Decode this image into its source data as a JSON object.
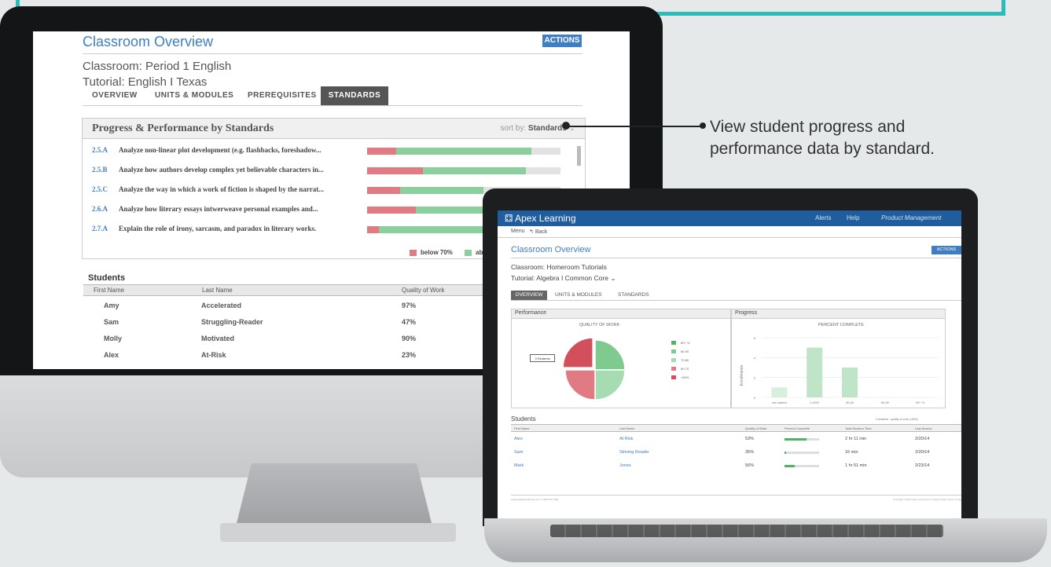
{
  "annotation": {
    "text_line1": "View student progress and",
    "text_line2": "performance data by standard."
  },
  "desktop": {
    "page_title": "Classroom Overview",
    "actions_label": "ACTIONS",
    "classroom": "Classroom: Period 1 English",
    "tutorial": "Tutorial: English I Texas",
    "tabs": [
      "OVERVIEW",
      "UNITS & MODULES",
      "PREREQUISITES",
      "STANDARDS"
    ],
    "active_tab": "STANDARDS",
    "panel_title": "Progress & Performance by Standards",
    "sort_label": "sort by:",
    "sort_value": "Standards",
    "standards": [
      {
        "code": "2.5.A",
        "text": "Analyze non-linear plot development (e.g. flashbacks, foreshadow...",
        "below": 0.15,
        "above": 0.85
      },
      {
        "code": "2.5.B",
        "text": "Analyze how authors develop complex yet believable characters in...",
        "below": 0.29,
        "above": 0.82
      },
      {
        "code": "2.5.C",
        "text": "Analyze the way in which a work of fiction is shaped by the narrat...",
        "below": 0.17,
        "above": 0.6
      },
      {
        "code": "2.6.A",
        "text": "Analyze how literary essays intwerweave personal examples and...",
        "below": 0.25,
        "above": 0.75
      },
      {
        "code": "2.7.A",
        "text": "Explain the role of irony, sarcasm, and paradox in literary works.",
        "below": 0.06,
        "above": 0.65
      }
    ],
    "legend": {
      "below": "below 70%",
      "above": "ab"
    },
    "students_title": "Students",
    "columns": [
      "First Name",
      "Last Name",
      "Quality of Work"
    ],
    "students": [
      {
        "first": "Amy",
        "last": "Accelerated",
        "quality": "97%"
      },
      {
        "first": "Sam",
        "last": "Struggling-Reader",
        "quality": "47%"
      },
      {
        "first": "Molly",
        "last": "Motivated",
        "quality": "90%"
      },
      {
        "first": "Alex",
        "last": "At-Risk",
        "quality": "23%"
      }
    ],
    "colors": {
      "accent": "#3f7ec2",
      "below": "#e07a83",
      "above": "#8ccf9e"
    }
  },
  "laptop": {
    "brand": "Apex Learning",
    "nav": [
      "Alerts",
      "Help"
    ],
    "nav_active": "Product Management",
    "menu": "Menu",
    "back": "Back",
    "page_title": "Classroom Overview",
    "actions_label": "ACTIONS",
    "classroom": "Classroom: Homeroom Tutorials",
    "tutorial": "Tutorial: Algebra I Common Core",
    "tabs": [
      "OVERVIEW",
      "UNITS & MODULES",
      "STANDARDS"
    ],
    "active_tab": "OVERVIEW",
    "performance": {
      "panel_title": "Performance",
      "chart_title": "QUALITY OF WORK",
      "tooltip": "3 Students",
      "legend": [
        "80+ %",
        "80-90",
        "70-80",
        "60-70",
        "<60%"
      ],
      "colors": [
        "#4cb565",
        "#7fca8f",
        "#a7dbb2",
        "#e07a83",
        "#d24f5c"
      ]
    },
    "progress": {
      "panel_title": "Progress",
      "chart_title": "PERCENT COMPLETE",
      "ylabel": "Enrollments",
      "yticks": [
        "0",
        "2",
        "4",
        "6"
      ],
      "categories": [
        "not started",
        "0-30%",
        "30-60",
        "60-90",
        "90+ %"
      ]
    },
    "students_title": "Students",
    "students_note": "3 students · quality of work (<60%)",
    "columns": [
      "First Name",
      "Last Name",
      "Quality of Work",
      "Percent Complete",
      "Total Session Time",
      "Last Access"
    ],
    "students": [
      {
        "first": "Alex",
        "last": "At Risk",
        "quality": "53%",
        "progress": 0.63,
        "time": "2 hr 11 min",
        "last_access": "2/20/14"
      },
      {
        "first": "Sam",
        "last": "Striving Reader",
        "quality": "35%",
        "progress": 0.05,
        "time": "16 min",
        "last_access": "2/20/14"
      },
      {
        "first": "Mark",
        "last": "Jones",
        "quality": "56%",
        "progress": 0.3,
        "time": "1 hr 51 min",
        "last_access": "2/23/14"
      }
    ],
    "footer_left": "support@apexlearning.com | 1 800 453 1454",
    "footer_right": "Copyright © 2014 Apex Learning Inc.   Privacy Policy   Terms of Use"
  },
  "chart_data": [
    {
      "type": "pie",
      "title": "QUALITY OF WORK",
      "categories": [
        "80+ %",
        "80-90",
        "70-80",
        "60-70",
        "<60%"
      ],
      "values": [
        0,
        1,
        1,
        1,
        1
      ]
    },
    {
      "type": "bar",
      "title": "PERCENT COMPLETE",
      "ylabel": "Enrollments",
      "categories": [
        "not started",
        "0-30%",
        "30-60",
        "60-90",
        "90+ %"
      ],
      "values": [
        1,
        5,
        3,
        0,
        0
      ],
      "ylim": [
        0,
        6
      ]
    }
  ]
}
